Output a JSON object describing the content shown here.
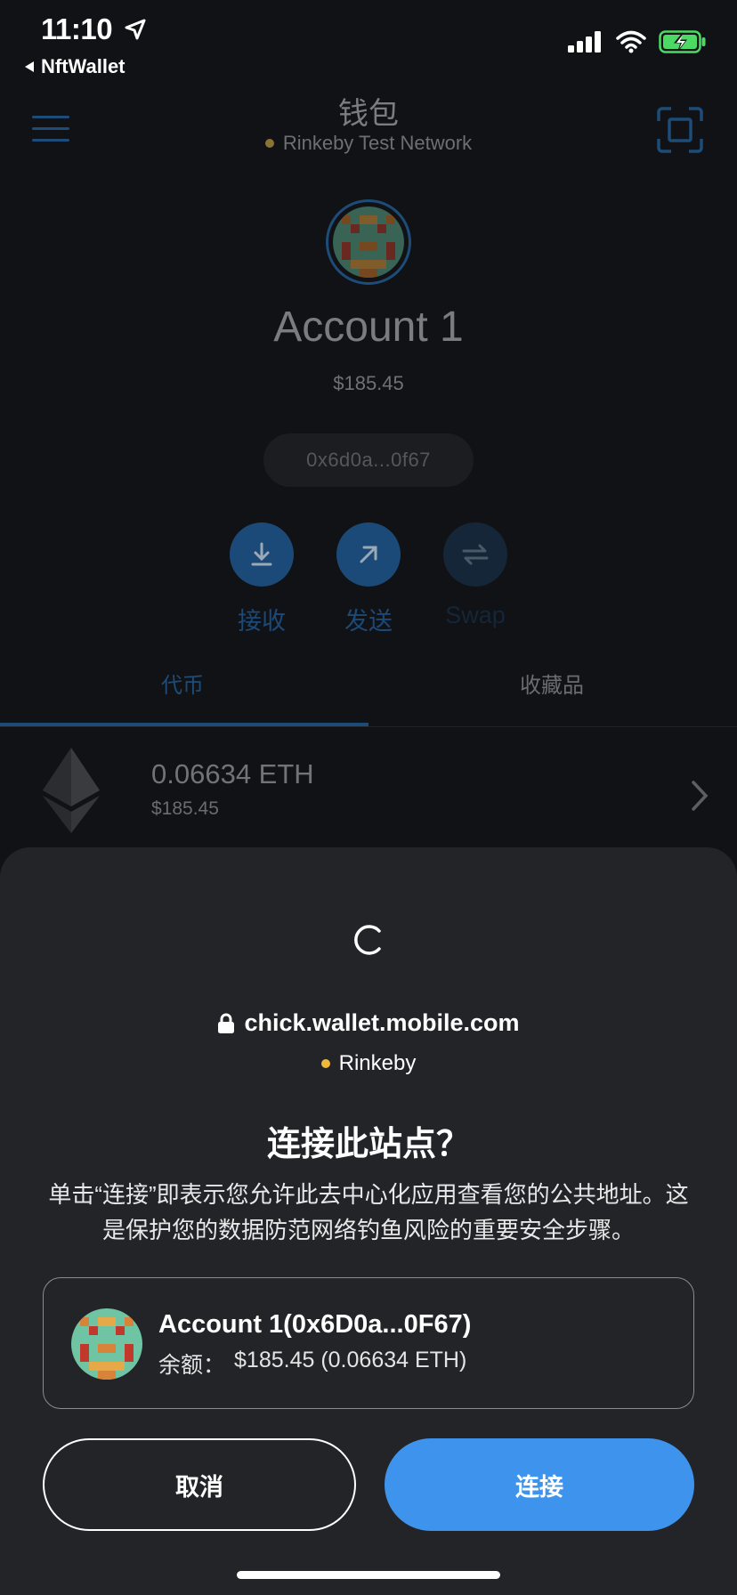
{
  "status_bar": {
    "time": "11:10",
    "back_app": "NftWallet"
  },
  "header": {
    "title": "钱包",
    "network": "Rinkeby Test Network",
    "network_dot_color": "#a88b3c"
  },
  "account": {
    "name": "Account 1",
    "balance": "$185.45",
    "address_short": "0x6d0a...0f67"
  },
  "actions": [
    {
      "label": "接收",
      "icon": "download-icon"
    },
    {
      "label": "发送",
      "icon": "send-arrow-icon"
    },
    {
      "label": "Swap",
      "icon": "swap-icon"
    }
  ],
  "tabs": [
    {
      "label": "代币",
      "active": true
    },
    {
      "label": "收藏品",
      "active": false
    }
  ],
  "token": {
    "amount": "0.06634 ETH",
    "fiat": "$185.45",
    "icon": "ethereum-icon"
  },
  "sheet": {
    "site": "chick.wallet.mobile.com",
    "chain": "Rinkeby",
    "chain_dot_color": "#f0b93c",
    "title": "连接此站点？",
    "description": "单击“连接”即表示您允许此去中心化应用查看您的公共地址。这是保护您的数据防范网络钓鱼风险的重要安全步骤。",
    "account_label": "Account 1(0x6D0a...0F67)",
    "balance_label": "余额：",
    "balance_value": "$185.45 (0.06634 ETH)",
    "cancel_label": "取消",
    "connect_label": "连接"
  },
  "colors": {
    "accent": "#3e93ec",
    "sheet_bg": "#232428",
    "page_bg": "#111215"
  }
}
